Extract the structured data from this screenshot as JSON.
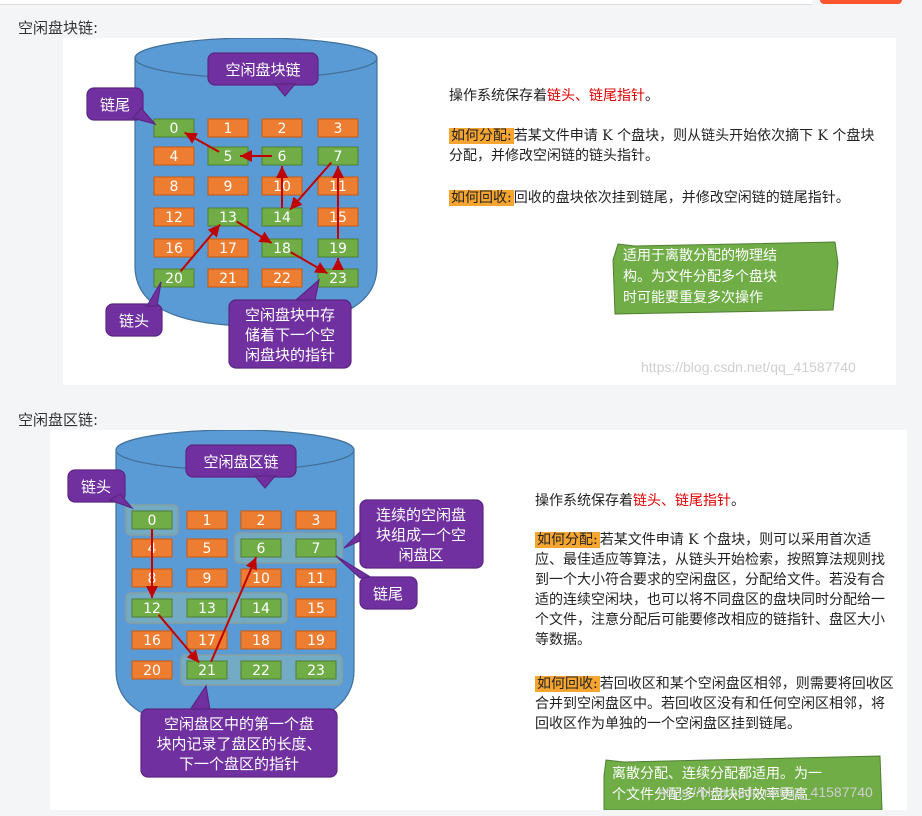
{
  "section1": {
    "label": "空闲盘块链:",
    "title_callout": "空闲盘块链",
    "tail_callout": "链尾",
    "head_callout": "链头",
    "pointer_callout": [
      "空闲盘块中存",
      "储着下一个空",
      "闲盘块的指针"
    ],
    "blocks": [
      "0",
      "1",
      "2",
      "3",
      "4",
      "5",
      "6",
      "7",
      "8",
      "9",
      "10",
      "11",
      "12",
      "13",
      "14",
      "15",
      "16",
      "17",
      "18",
      "19",
      "20",
      "21",
      "22",
      "23"
    ],
    "free_blocks": [
      "0",
      "5",
      "6",
      "7",
      "13",
      "14",
      "18",
      "19",
      "20",
      "23"
    ],
    "desc_intro": "操作系统保存着",
    "desc_intro_red": "链头、链尾指针",
    "desc_intro_end": "。",
    "alloc_label": "如何分配:",
    "alloc_text": "若某文件申请 K 个盘块，则从链头开始依次摘下 K 个盘块分配，并修改空闲链的链头指针。",
    "recycle_label": "如何回收:",
    "recycle_text": "回收的盘块依次挂到链尾，并修改空闲链的链尾指针。",
    "note_lines": [
      "适用于离散分配的物理结",
      "构。为文件分配多个盘块",
      "时可能要重复多次操作"
    ],
    "watermark": "https://blog.csdn.net/qq_41587740"
  },
  "section2": {
    "label": "空闲盘区链:",
    "title_callout": "空闲盘区链",
    "head_callout": "链头",
    "tail_callout": "链尾",
    "extent_callout": [
      "连续的空闲盘",
      "块组成一个空",
      "闲盘区"
    ],
    "pointer_callout": [
      "空闲盘区中的第一个盘",
      "块内记录了盘区的长度、",
      "下一个盘区的指针"
    ],
    "blocks": [
      "0",
      "1",
      "2",
      "3",
      "4",
      "5",
      "6",
      "7",
      "8",
      "9",
      "10",
      "11",
      "12",
      "13",
      "14",
      "15",
      "16",
      "17",
      "18",
      "19",
      "20",
      "21",
      "22",
      "23"
    ],
    "free_blocks": [
      "0",
      "6",
      "7",
      "12",
      "13",
      "14",
      "21",
      "22",
      "23"
    ],
    "desc_intro": "操作系统保存着",
    "desc_intro_red": "链头、链尾指针",
    "desc_intro_end": "。",
    "alloc_label": "如何分配:",
    "alloc_text": "若某文件申请 K 个盘块，则可以采用首次适应、最佳适应等算法，从链头开始检索，按照算法规则找到一个大小符合要求的空闲盘区，分配给文件。若没有合适的连续空闲块，也可以将不同盘区的盘块同时分配给一个文件，注意分配后可能要修改相应的链指针、盘区大小等数据。",
    "recycle_label": "如何回收:",
    "recycle_text": "若回收区和某个空闲盘区相邻，则需要将回收区合并到空闲盘区中。若回收区没有和任何空闲区相邻，将回收区作为单独的一个空闲盘区挂到链尾。",
    "note_lines": [
      "离散分配、连续分配都适用。为一",
      "个文件分配多个盘块时效率更高"
    ],
    "watermark": "https://blog.csdn.net/qq_41587740"
  }
}
